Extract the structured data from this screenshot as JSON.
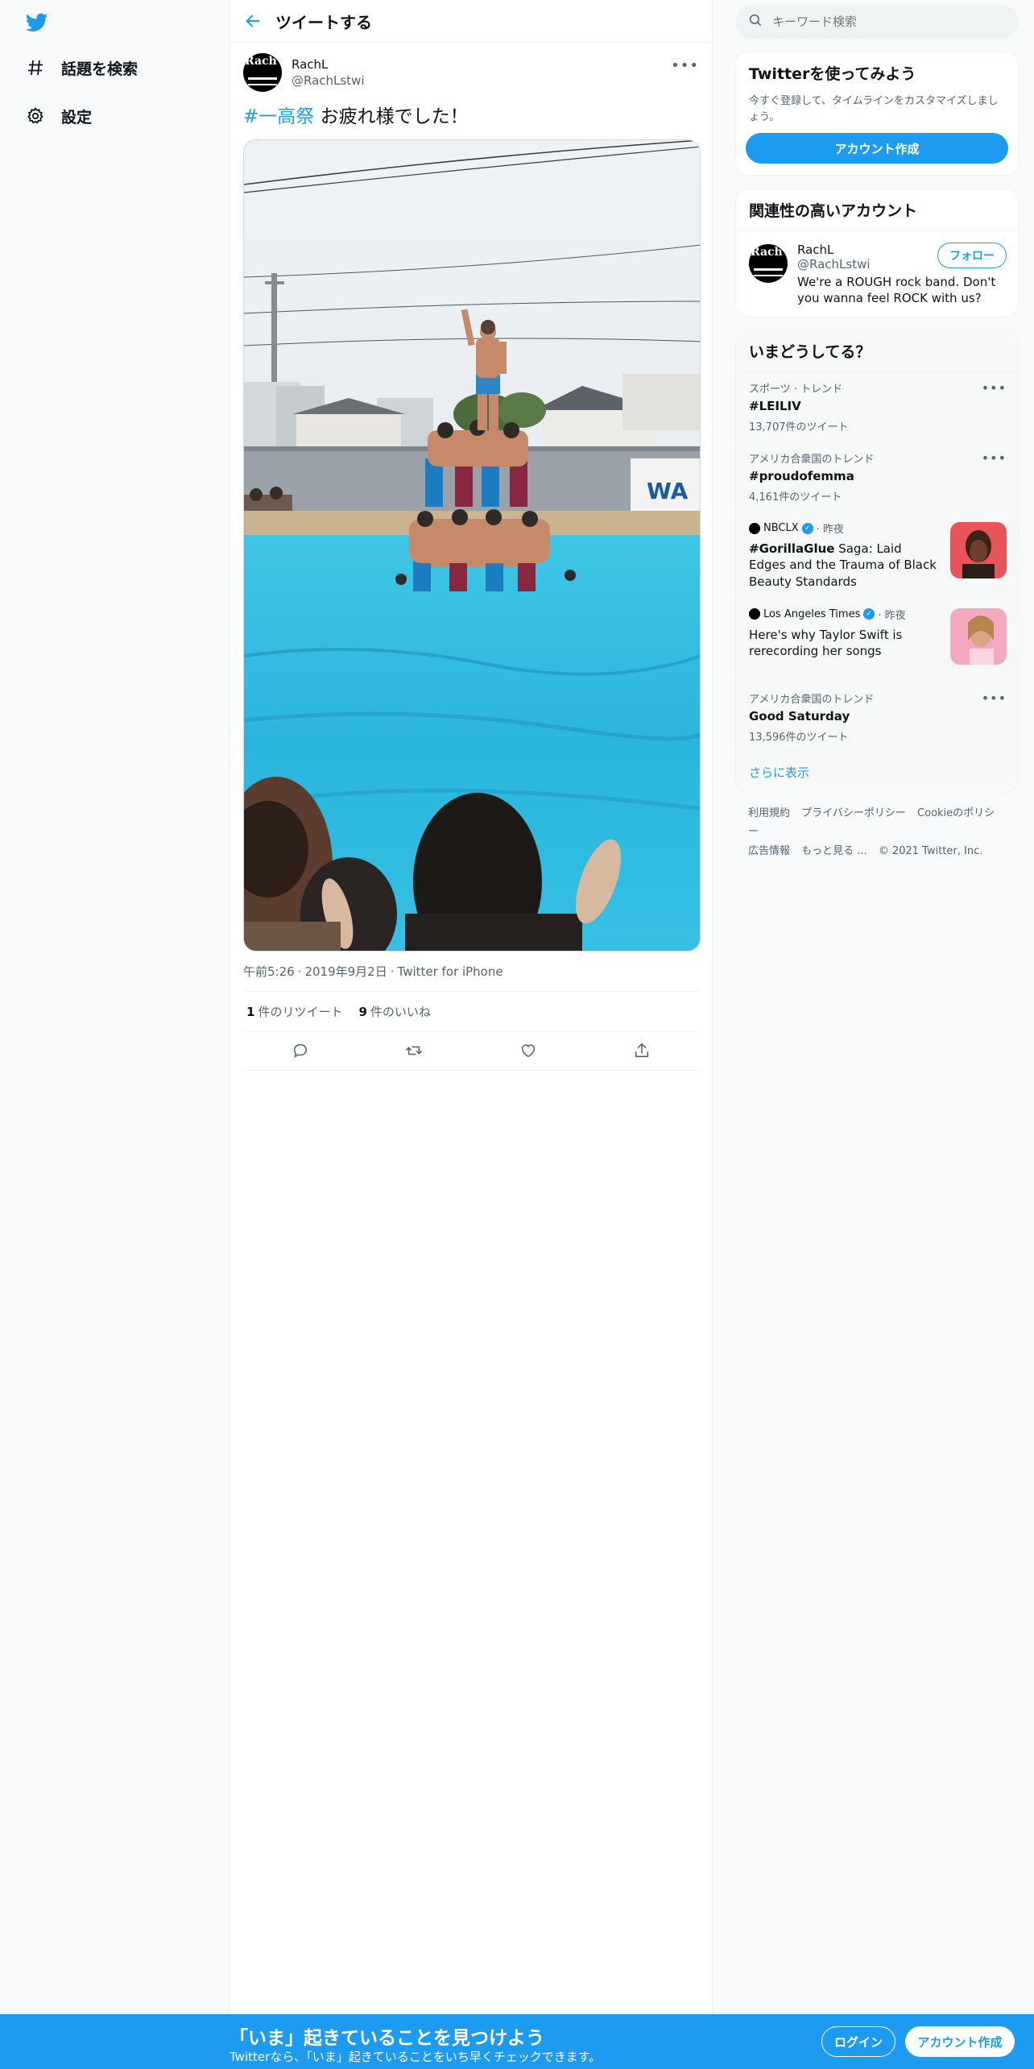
{
  "nav": {
    "explore_label": "話題を検索",
    "settings_label": "設定"
  },
  "header": {
    "title": "ツイートする"
  },
  "tweet": {
    "author_name": "RachL",
    "author_handle": "@RachLstwi",
    "avatar_text": "Rach",
    "hashtag": "#一高祭",
    "text": " お疲れ様でした！",
    "time": "午前5:26",
    "date": "2019年9月2日",
    "source": "Twitter for iPhone",
    "retweet_count": "1",
    "retweet_label": "件のリツイート",
    "like_count": "9",
    "like_label": "件のいいね",
    "media_banner_text": "WA"
  },
  "search": {
    "placeholder": "キーワード検索"
  },
  "signup_card": {
    "title": "Twitterを使ってみよう",
    "description": "今すぐ登録して、タイムラインをカスタマイズしましょう。",
    "button": "アカウント作成"
  },
  "related": {
    "title": "関連性の高いアカウント",
    "name": "RachL",
    "handle": "@RachLstwi",
    "bio": "We're a ROUGH rock band. Don't you wanna feel ROCK with us?",
    "follow_label": "フォロー"
  },
  "trends": {
    "title": "いまどうしてる？",
    "items": [
      {
        "context": "スポーツ · トレンド",
        "name": "#LEILIV",
        "count": "13,707件のツイート"
      },
      {
        "context": "アメリカ合衆国のトレンド",
        "name": "#proudofemma",
        "count": "4,161件のツイート"
      },
      {
        "context": "アメリカ合衆国のトレンド",
        "name": "Good Saturday",
        "count": "13,596件のツイート"
      }
    ],
    "news": [
      {
        "source": "NBCLX",
        "time": "· 昨夜",
        "title_bold": "#GorillaGlue",
        "title": " Saga: Laid Edges and the Trauma of Black Beauty Standards"
      },
      {
        "source": "Los Angeles Times",
        "time": "· 昨夜",
        "title_bold": "",
        "title": "Here's why Taylor Swift is rerecording her songs"
      }
    ],
    "show_more": "さらに表示"
  },
  "footer": {
    "terms": "利用規約",
    "privacy": "プライバシーポリシー",
    "cookie": "Cookieのポリシー",
    "ads": "広告情報",
    "more": "もっと見る ...",
    "copyright": "© 2021 Twitter, Inc."
  },
  "bottom_bar": {
    "title": "「いま」起きていることを見つけよう",
    "subtitle": "Twitterなら、「いま」起きていることをいち早くチェックできます。",
    "login": "ログイン",
    "signup": "アカウント作成"
  },
  "colors": {
    "accent": "#1d9bf0",
    "text": "#0f1419",
    "secondary": "#536471"
  },
  "icons": [
    "twitter-logo-icon",
    "hashtag-icon",
    "gear-icon",
    "back-arrow-icon",
    "more-icon",
    "reply-icon",
    "retweet-icon",
    "like-icon",
    "share-icon",
    "search-icon",
    "verified-icon"
  ]
}
